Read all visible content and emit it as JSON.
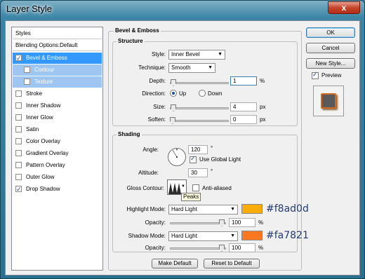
{
  "window": {
    "title": "Layer Style",
    "close_glyph": "x"
  },
  "styles_list": {
    "header": "Styles",
    "blending_options": "Blending Options:Default",
    "items": [
      {
        "label": "Bevel & Emboss",
        "checked": true,
        "selected": true
      },
      {
        "label": "Contour",
        "checked": false,
        "sub": true
      },
      {
        "label": "Texture",
        "checked": false,
        "sub": true
      },
      {
        "label": "Stroke",
        "checked": false
      },
      {
        "label": "Inner Shadow",
        "checked": false
      },
      {
        "label": "Inner Glow",
        "checked": false
      },
      {
        "label": "Satin",
        "checked": false
      },
      {
        "label": "Color Overlay",
        "checked": false
      },
      {
        "label": "Gradient Overlay",
        "checked": false
      },
      {
        "label": "Pattern Overlay",
        "checked": false
      },
      {
        "label": "Outer Glow",
        "checked": false
      },
      {
        "label": "Drop Shadow",
        "checked": true
      }
    ]
  },
  "bevel": {
    "title": "Bevel & Emboss",
    "structure": {
      "title": "Structure",
      "style_label": "Style:",
      "style_value": "Inner Bevel",
      "technique_label": "Technique:",
      "technique_value": "Smooth",
      "depth_label": "Depth:",
      "depth_value": "1",
      "depth_unit": "%",
      "depth_level": 0.01,
      "direction_label": "Direction:",
      "dir_up": "Up",
      "dir_down": "Down",
      "direction_selected": "Up",
      "size_label": "Size:",
      "size_value": "4",
      "size_unit": "px",
      "size_level": 0.016,
      "soften_label": "Soften:",
      "soften_value": "0",
      "soften_unit": "px",
      "soften_level": 0.0
    },
    "shading": {
      "title": "Shading",
      "angle_label": "Angle:",
      "angle_value": "120",
      "angle_unit": "°",
      "use_global_light": "Use Global Light",
      "use_global_light_checked": true,
      "altitude_label": "Altitude:",
      "altitude_value": "30",
      "altitude_unit": "°",
      "gloss_label": "Gloss Contour:",
      "anti_aliased": "Anti-aliased",
      "anti_aliased_checked": false,
      "tooltip": "Peaks",
      "highlight_label": "Highlight Mode:",
      "highlight_value": "Hard Light",
      "highlight_color": "#f8ad0d",
      "highlight_hex": "#f8ad0d",
      "hl_opacity_label": "Opacity:",
      "hl_opacity_value": "100",
      "hl_opacity_unit": "%",
      "hl_opacity_level": 1.0,
      "shadow_label": "Shadow Mode:",
      "shadow_value": "Hard Light",
      "shadow_color": "#fa7821",
      "shadow_hex": "#fa7821",
      "sh_opacity_label": "Opacity:",
      "sh_opacity_value": "100",
      "sh_opacity_unit": "%",
      "sh_opacity_level": 1.0
    },
    "make_default": "Make Default",
    "reset_default": "Reset to Default"
  },
  "actions": {
    "ok": "OK",
    "cancel": "Cancel",
    "new_style": "New Style...",
    "preview": "Preview",
    "preview_checked": true
  },
  "colors": {
    "accent": "#3399ff",
    "preview_swatch": "#5a5a5a",
    "preview_border": "#d2691e"
  }
}
